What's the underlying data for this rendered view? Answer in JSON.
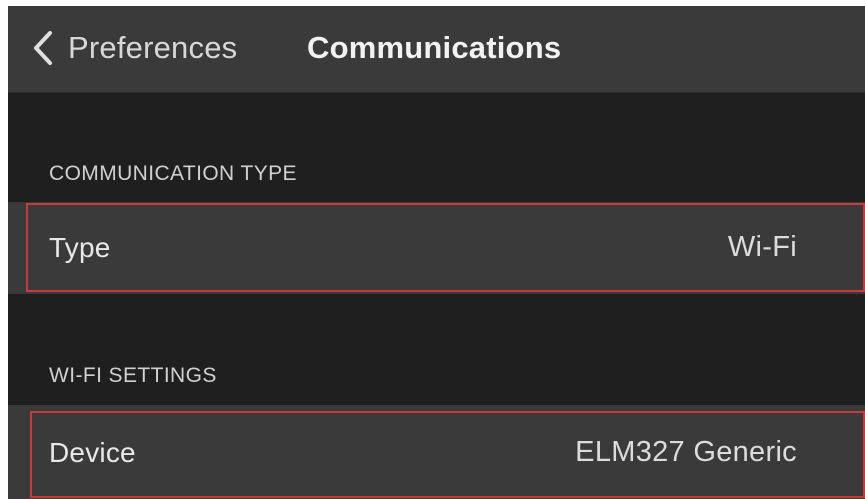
{
  "nav": {
    "back_label": "Preferences",
    "title": "Communications"
  },
  "sections": {
    "communication_type": {
      "header": "COMMUNICATION TYPE",
      "type_label": "Type",
      "type_value": "Wi-Fi"
    },
    "wifi_settings": {
      "header": "WI-FI SETTINGS",
      "device_label": "Device",
      "device_value": "ELM327 Generic"
    }
  },
  "colors": {
    "background": "#1f1f1f",
    "bar": "#3a3a3a",
    "highlight": "#c83a3a",
    "text": "#e8e8e8"
  },
  "icons": {
    "back": "chevron-left-icon"
  }
}
